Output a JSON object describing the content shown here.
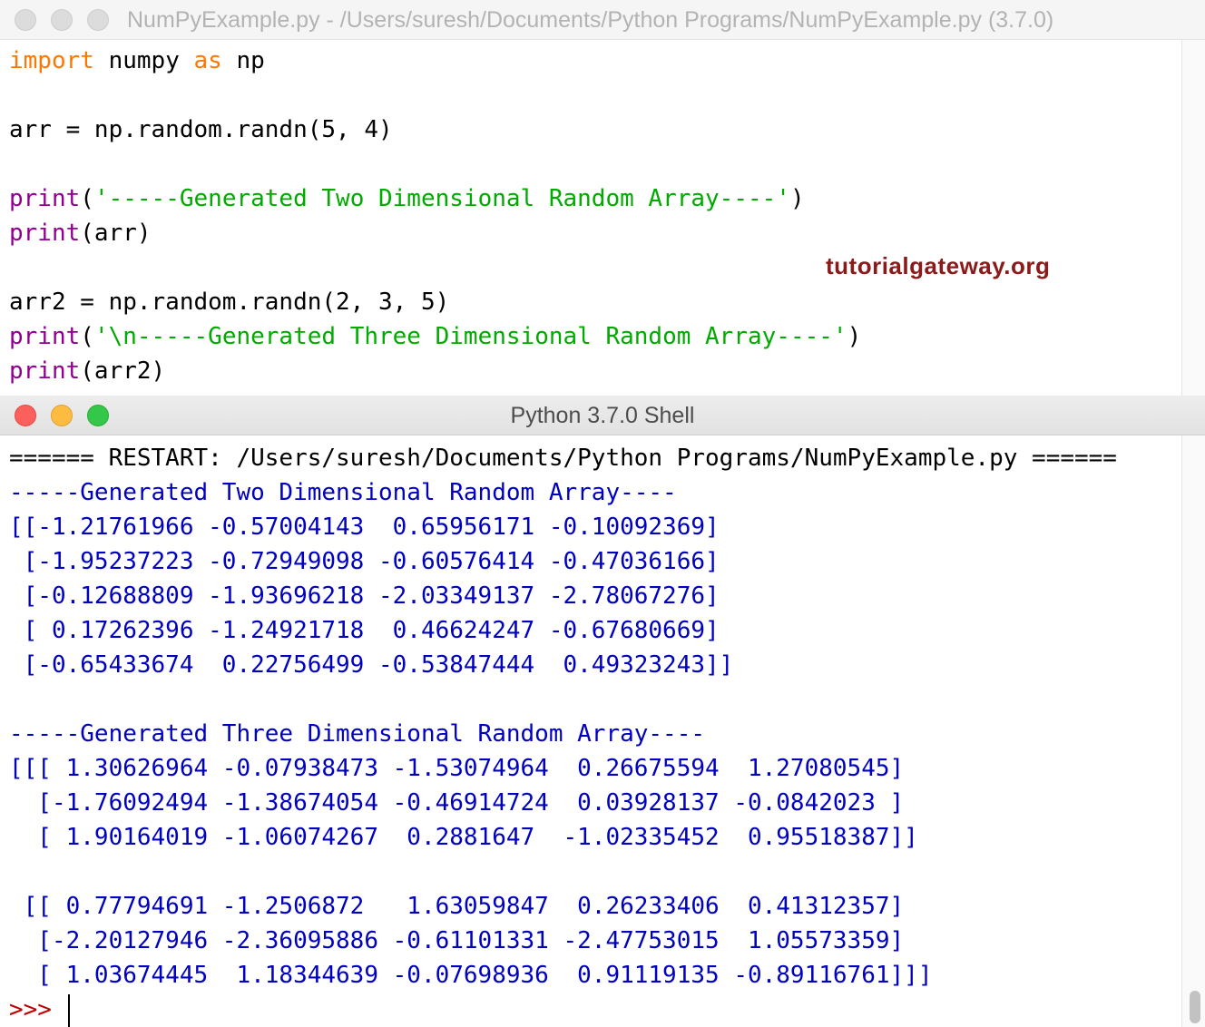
{
  "editor": {
    "title": "NumPyExample.py - /Users/suresh/Documents/Python Programs/NumPyExample.py (3.7.0)",
    "watermark": "tutorialgateway.org",
    "lines": {
      "l1": {
        "kw1": "import",
        "t1": " numpy ",
        "kw2": "as",
        "t2": " np"
      },
      "l3": {
        "t": "arr = np.random.randn(5, 4)"
      },
      "l5": {
        "fn": "print",
        "o": "(",
        "s": "'-----Generated Two Dimensional Random Array----'",
        "c": ")"
      },
      "l6": {
        "fn": "print",
        "t": "(arr)"
      },
      "l8": {
        "t": "arr2 = np.random.randn(2, 3, 5)"
      },
      "l9": {
        "fn": "print",
        "o": "(",
        "s": "'\\n-----Generated Three Dimensional Random Array----'",
        "c": ")"
      },
      "l10": {
        "fn": "print",
        "t": "(arr2)"
      }
    }
  },
  "shell": {
    "title": "Python 3.7.0 Shell",
    "restart": "====== RESTART: /Users/suresh/Documents/Python Programs/NumPyExample.py ======",
    "out": [
      "-----Generated Two Dimensional Random Array----",
      "[[-1.21761966 -0.57004143  0.65956171 -0.10092369]",
      " [-1.95237223 -0.72949098 -0.60576414 -0.47036166]",
      " [-0.12688809 -1.93696218 -2.03349137 -2.78067276]",
      " [ 0.17262396 -1.24921718  0.46624247 -0.67680669]",
      " [-0.65433674  0.22756499 -0.53847444  0.49323243]]",
      "",
      "-----Generated Three Dimensional Random Array----",
      "[[[ 1.30626964 -0.07938473 -1.53074964  0.26675594  1.27080545]",
      "  [-1.76092494 -1.38674054 -0.46914724  0.03928137 -0.0842023 ]",
      "  [ 1.90164019 -1.06074267  0.2881647  -1.02335452  0.95518387]]",
      "",
      " [[ 0.77794691 -1.2506872   1.63059847  0.26233406  0.41312357]",
      "  [-2.20127946 -2.36095886 -0.61101331 -2.47753015  1.05573359]",
      "  [ 1.03674445  1.18344639 -0.07698936  0.91119135 -0.89116761]]]"
    ],
    "prompt": ">>> "
  }
}
